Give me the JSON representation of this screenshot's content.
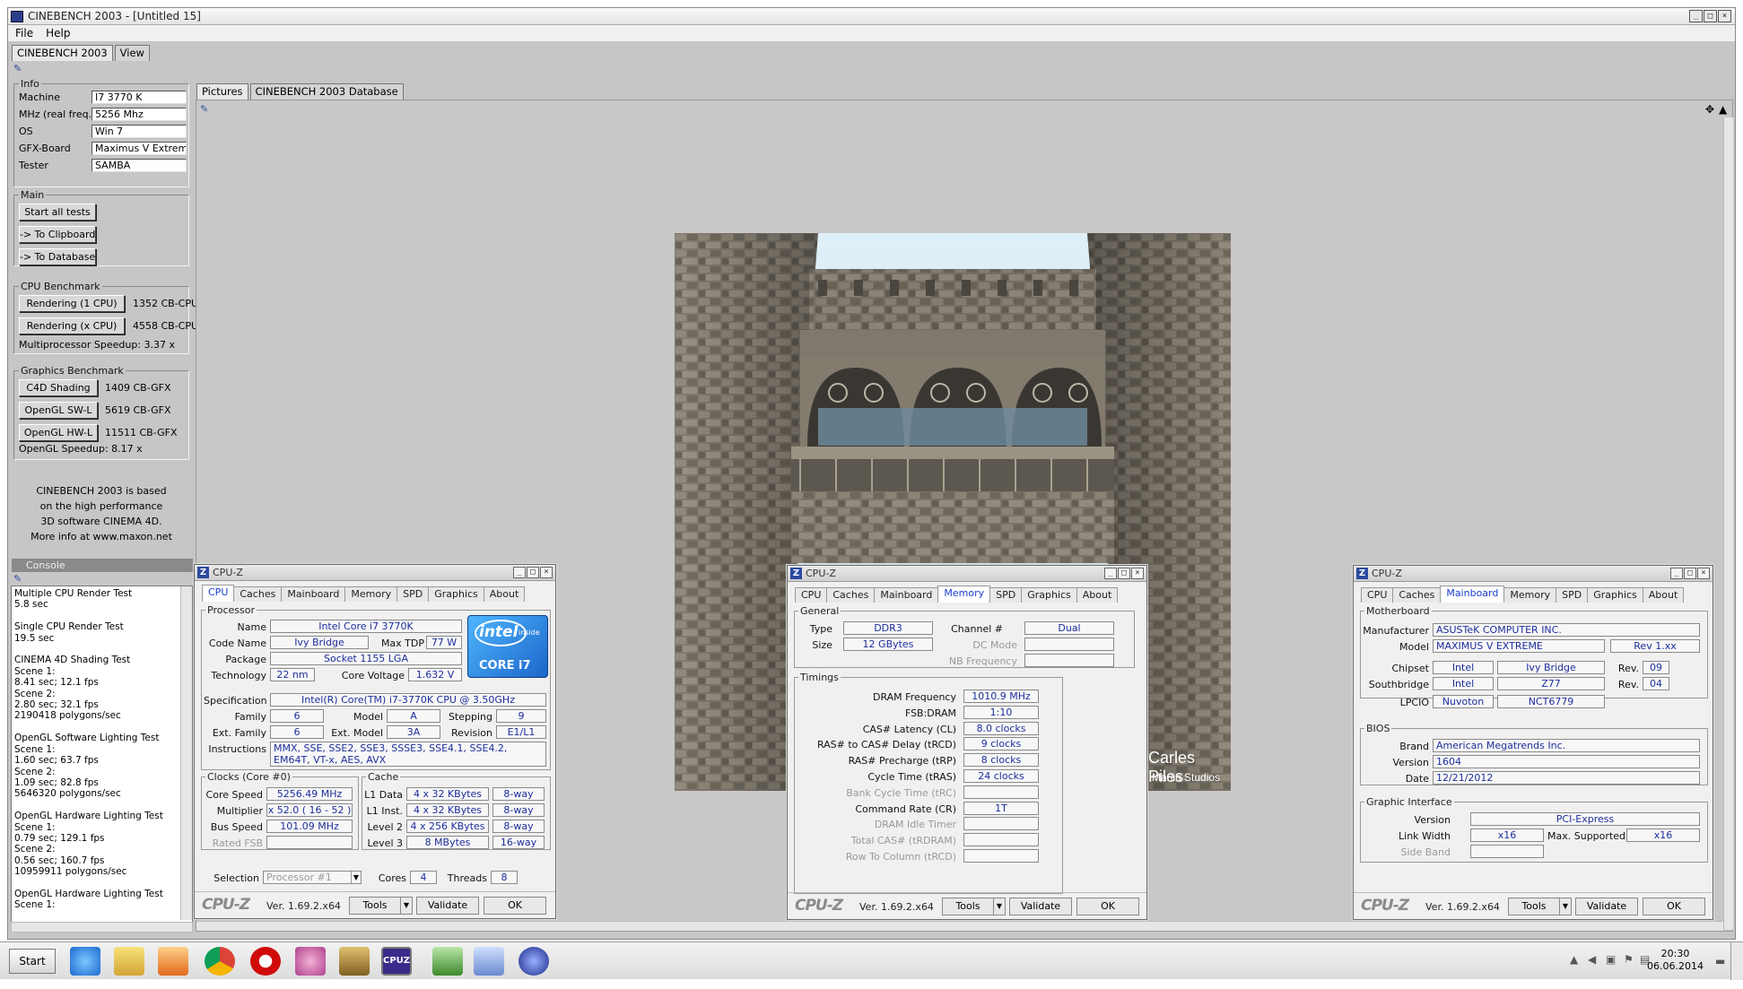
{
  "window": {
    "title": "CINEBENCH 2003 - [Untitled 15]",
    "min": "_",
    "max": "□",
    "close": "×"
  },
  "menu": [
    "File",
    "Help"
  ],
  "app_tabs": [
    "CINEBENCH 2003",
    "View"
  ],
  "info": {
    "legend": "Info",
    "rows": [
      [
        "Machine",
        "I7 3770 K"
      ],
      [
        "MHz (real freq.)",
        "5256 Mhz"
      ],
      [
        "OS",
        "Win 7"
      ],
      [
        "GFX-Board",
        "Maximus V Extreme"
      ],
      [
        "Tester",
        "SAMBA"
      ]
    ]
  },
  "main": {
    "legend": "Main",
    "buttons": [
      "Start all tests",
      "-> To Clipboard",
      "-> To Database"
    ]
  },
  "cpu_bench": {
    "legend": "CPU Benchmark",
    "rows": [
      [
        "Rendering (1 CPU)",
        "1352 CB-CPU"
      ],
      [
        "Rendering (x CPU)",
        "4558 CB-CPU"
      ]
    ],
    "speedup": "Multiprocessor Speedup:  3.37 x"
  },
  "gfx_bench": {
    "legend": "Graphics Benchmark",
    "rows": [
      [
        "C4D Shading",
        "1409 CB-GFX"
      ],
      [
        "OpenGL SW-L",
        "5619 CB-GFX"
      ],
      [
        "OpenGL HW-L",
        "11511 CB-GFX"
      ]
    ],
    "speedup": "OpenGL Speedup:  8.17 x"
  },
  "about_text": [
    "CINEBENCH 2003 is based",
    "on the high performance",
    "3D software CINEMA 4D.",
    "More info at www.maxon.net"
  ],
  "console": {
    "title": "Console",
    "text": "Multiple CPU Render Test\n5.8 sec\n\nSingle CPU Render Test\n19.5 sec\n\nCINEMA 4D Shading Test\nScene 1:\n8.41 sec; 12.1 fps\nScene 2:\n2.80 sec; 32.1 fps\n2190418 polygons/sec\n\nOpenGL Software Lighting Test\nScene 1:\n1.60 sec; 63.7 fps\nScene 2:\n1.09 sec; 82.8 fps\n5646320 polygons/sec\n\nOpenGL Hardware Lighting Test\nScene 1:\n0.79 sec; 129.1 fps\nScene 2:\n0.56 sec; 160.7 fps\n10959911 polygons/sec\n\nOpenGL Hardware Lighting Test\nScene 1:"
  },
  "pictures_tabs": [
    "Pictures",
    "CINEBENCH 2003 Database"
  ],
  "render": {
    "credit1": "Carles Piles",
    "credit2": "Marlin Studios"
  },
  "cpuz_common": {
    "title": "CPU-Z",
    "logo": "CPU-Z",
    "version": "Ver. 1.69.2.x64",
    "tools": "Tools",
    "validate": "Validate",
    "ok": "OK",
    "tabs": [
      "CPU",
      "Caches",
      "Mainboard",
      "Memory",
      "SPD",
      "Graphics",
      "About"
    ]
  },
  "cpuz1": {
    "processor_legend": "Processor",
    "name": [
      "Name",
      "Intel Core i7 3770K"
    ],
    "codename": [
      "Code Name",
      "Ivy Bridge"
    ],
    "maxtdp": [
      "Max TDP",
      "77 W"
    ],
    "package": [
      "Package",
      "Socket 1155 LGA"
    ],
    "technology": [
      "Technology",
      "22 nm"
    ],
    "corevoltage": [
      "Core Voltage",
      "1.632 V"
    ],
    "spec": [
      "Specification",
      "Intel(R) Core(TM) i7-3770K CPU @ 3.50GHz"
    ],
    "family": [
      "Family",
      "6"
    ],
    "model": [
      "Model",
      "A"
    ],
    "stepping": [
      "Stepping",
      "9"
    ],
    "extfamily": [
      "Ext. Family",
      "6"
    ],
    "extmodel": [
      "Ext. Model",
      "3A"
    ],
    "revision": [
      "Revision",
      "E1/L1"
    ],
    "instructions_label": "Instructions",
    "instructions": "MMX, SSE, SSE2, SSE3, SSSE3, SSE4.1, SSE4.2, EM64T, VT-x, AES, AVX",
    "clocks_legend": "Clocks (Core #0)",
    "clocks": [
      [
        "Core Speed",
        "5256.49 MHz"
      ],
      [
        "Multiplier",
        "x 52.0 ( 16 - 52 )"
      ],
      [
        "Bus Speed",
        "101.09 MHz"
      ],
      [
        "Rated FSB",
        ""
      ]
    ],
    "cache_legend": "Cache",
    "cache": [
      [
        "L1 Data",
        "4 x 32 KBytes",
        "8-way"
      ],
      [
        "L1 Inst.",
        "4 x 32 KBytes",
        "8-way"
      ],
      [
        "Level 2",
        "4 x 256 KBytes",
        "8-way"
      ],
      [
        "Level 3",
        "8 MBytes",
        "16-way"
      ]
    ],
    "selection": [
      "Selection",
      "Processor #1"
    ],
    "cores": [
      "Cores",
      "4"
    ],
    "threads": [
      "Threads",
      "8"
    ],
    "badge_brand": "intel",
    "badge_inside": "inside",
    "badge_model": "CORE i7"
  },
  "cpuz2": {
    "general_legend": "General",
    "type": [
      "Type",
      "DDR3"
    ],
    "channel": [
      "Channel #",
      "Dual"
    ],
    "size": [
      "Size",
      "12 GBytes"
    ],
    "dcmode": [
      "DC Mode",
      ""
    ],
    "nbfreq": [
      "NB Frequency",
      ""
    ],
    "timings_legend": "Timings",
    "timings": [
      [
        "DRAM Frequency",
        "1010.9 MHz"
      ],
      [
        "FSB:DRAM",
        "1:10"
      ],
      [
        "CAS# Latency (CL)",
        "8.0 clocks"
      ],
      [
        "RAS# to CAS# Delay (tRCD)",
        "9 clocks"
      ],
      [
        "RAS# Precharge (tRP)",
        "8 clocks"
      ],
      [
        "Cycle Time (tRAS)",
        "24 clocks"
      ],
      [
        "Bank Cycle Time (tRC)",
        ""
      ],
      [
        "Command Rate (CR)",
        "1T"
      ],
      [
        "DRAM Idle Timer",
        ""
      ],
      [
        "Total CAS# (tRDRAM)",
        ""
      ],
      [
        "Row To Column (tRCD)",
        ""
      ]
    ]
  },
  "cpuz3": {
    "mb_legend": "Motherboard",
    "manufacturer": [
      "Manufacturer",
      "ASUSTeK COMPUTER INC."
    ],
    "model": [
      "Model",
      "MAXIMUS V EXTREME",
      "Rev 1.xx"
    ],
    "chipset": [
      "Chipset",
      "Intel",
      "Ivy Bridge",
      "Rev.",
      "09"
    ],
    "southbridge": [
      "Southbridge",
      "Intel",
      "Z77",
      "Rev.",
      "04"
    ],
    "lpcio": [
      "LPCIO",
      "Nuvoton",
      "NCT6779"
    ],
    "bios_legend": "BIOS",
    "brand": [
      "Brand",
      "American Megatrends Inc."
    ],
    "version": [
      "Version",
      "1604"
    ],
    "date": [
      "Date",
      "12/21/2012"
    ],
    "gi_legend": "Graphic Interface",
    "gi_version": [
      "Version",
      "PCI-Express"
    ],
    "linkwidth": [
      "Link Width",
      "x16"
    ],
    "maxsupported": [
      "Max. Supported",
      "x16"
    ],
    "sideband": [
      "Side Band",
      ""
    ]
  },
  "taskbar": {
    "start": "Start",
    "time": "20:30",
    "date": "06.06.2014",
    "cpuz_icon_text": "CPUZ"
  }
}
